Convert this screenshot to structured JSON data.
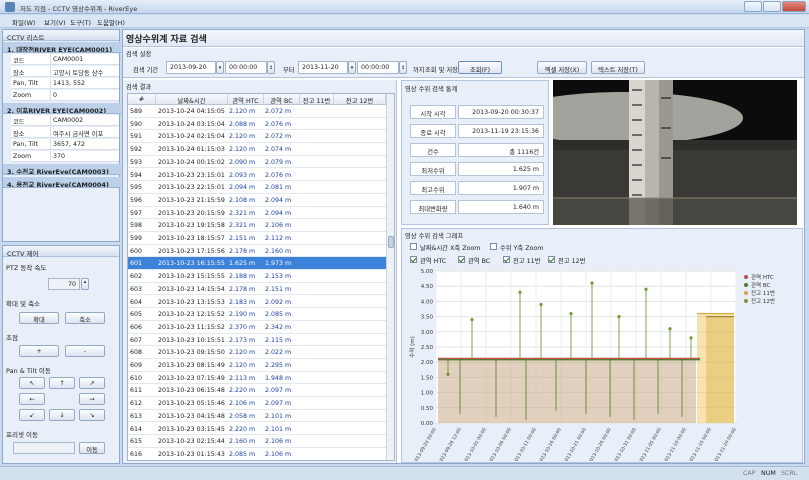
{
  "window": {
    "title": "저도 지점 - CCTV 영상수위계 - RiverEye"
  },
  "menu": [
    "파일(W)",
    "보기(V)",
    "도구(T)",
    "도움말(H)"
  ],
  "cctv_list": {
    "title": "CCTV 리스트",
    "cameras": [
      {
        "header": "1. 대장천RIVER EYE(CAM0001)",
        "props": [
          [
            "코드",
            "CAM0001"
          ],
          [
            "장소",
            "고양시 토당동 상수"
          ],
          [
            "Pan, Tilt",
            "1413, 552"
          ],
          [
            "Zoom",
            "0"
          ]
        ]
      },
      {
        "header": "2. 이포RIVER EYE(CAM0002)",
        "props": [
          [
            "코드",
            "CAM0002"
          ],
          [
            "장소",
            "여주시 금사면 이포"
          ],
          [
            "Pan, Tilt",
            "3657, 472"
          ],
          [
            "Zoom",
            "370"
          ]
        ]
      },
      {
        "header": "3. 수전교 RiverEye(CAM0003)"
      },
      {
        "header": "4. 용전교 RiverEye(CAM0004)"
      }
    ]
  },
  "cctv_control": {
    "title": "CCTV 제어",
    "ptz_label": "PTZ 동작 속도",
    "ptz_speed": "70",
    "zoom_label": "확대 및 축소",
    "zoom_in": "확대",
    "zoom_out": "축소",
    "focus_label": "초점",
    "focus_plus": "+",
    "focus_minus": "-",
    "pantilt_label": "Pan & Tilt 이동",
    "arrows": [
      "↖",
      "↑",
      "↗",
      "←",
      "",
      "→",
      "↙",
      "↓",
      "↘"
    ],
    "preset_label": "프리셋 이동",
    "preset_button": "이동"
  },
  "search": {
    "page_title": "영상수위계 자료 검색",
    "settings_label": "검색 설정",
    "period_label": "검색 기간",
    "start_date": "2013-09-20",
    "start_time": "00:00:00",
    "from_label": "부터",
    "end_date": "2013-11-20",
    "end_time": "00:00:00",
    "to_label": "까지",
    "query_save_label": "조회 및 저장",
    "query_button": "조회(F)",
    "excel_button": "엑셀 저장(X)",
    "text_button": "텍스트 저장(T)"
  },
  "results": {
    "title": "검색 결과",
    "columns": [
      "#",
      "날짜&시간",
      "관역 HTC",
      "관역 BC",
      "전고 11번",
      "전고 12번"
    ],
    "rows": [
      [
        "589",
        "2013-10-24 04:15:05",
        "2.120 m",
        "2.072 m"
      ],
      [
        "590",
        "2013-10-24 03:15:04",
        "2.088 m",
        "2.076 m"
      ],
      [
        "591",
        "2013-10-24 02:15:04",
        "2.120 m",
        "2.072 m"
      ],
      [
        "592",
        "2013-10-24 01:15:03",
        "2.120 m",
        "2.074 m"
      ],
      [
        "593",
        "2013-10-24 00:15:02",
        "2.090 m",
        "2.079 m"
      ],
      [
        "594",
        "2013-10-23 23:15:01",
        "2.093 m",
        "2.076 m"
      ],
      [
        "595",
        "2013-10-23 22:15:01",
        "2.094 m",
        "2.081 m"
      ],
      [
        "596",
        "2013-10-23 21:15:59",
        "2.108 m",
        "2.094 m"
      ],
      [
        "597",
        "2013-10-23 20:15:59",
        "2.321 m",
        "2.094 m"
      ],
      [
        "598",
        "2013-10-23 19:15:58",
        "2.321 m",
        "2.106 m"
      ],
      [
        "599",
        "2013-10-23 18:15:57",
        "2.151 m",
        "2.112 m"
      ],
      [
        "600",
        "2013-10-23 17:15:56",
        "2.178 m",
        "2.160 m"
      ],
      [
        "601",
        "2013-10-23 16:15:55",
        "1.625 m",
        "1.973 m"
      ],
      [
        "602",
        "2013-10-23 15:15:55",
        "2.188 m",
        "2.153 m"
      ],
      [
        "603",
        "2013-10-23 14:15:54",
        "2.178 m",
        "2.151 m"
      ],
      [
        "604",
        "2013-10-23 13:15:53",
        "2.183 m",
        "2.092 m"
      ],
      [
        "605",
        "2013-10-23 12:15:52",
        "2.190 m",
        "2.085 m"
      ],
      [
        "606",
        "2013-10-23 11:15:52",
        "2.370 m",
        "2.342 m"
      ],
      [
        "607",
        "2013-10-23 10:15:51",
        "2.173 m",
        "2.115 m"
      ],
      [
        "608",
        "2013-10-23 09:15:50",
        "2.120 m",
        "2.022 m"
      ],
      [
        "609",
        "2013-10-23 08:15:49",
        "2.120 m",
        "2.295 m"
      ],
      [
        "610",
        "2013-10-23 07:15:49",
        "2.113 m",
        "1.948 m"
      ],
      [
        "611",
        "2013-10-23 06:15:48",
        "2.220 m",
        "2.097 m"
      ],
      [
        "612",
        "2013-10-23 05:15:46",
        "2.106 m",
        "2.097 m"
      ],
      [
        "613",
        "2013-10-23 04:15:48",
        "2.058 m",
        "2.101 m"
      ],
      [
        "614",
        "2013-10-23 03:15:45",
        "2.220 m",
        "2.101 m"
      ],
      [
        "615",
        "2013-10-23 02:15:44",
        "2.160 m",
        "2.106 m"
      ],
      [
        "616",
        "2013-10-23 01:15:43",
        "2.085 m",
        "2.106 m"
      ]
    ],
    "selected_index": 12
  },
  "stats": {
    "title": "영상 수위 검색 통계",
    "items": [
      [
        "시작 시각",
        "2013-09-20 00:30:37"
      ],
      [
        "종료 시각",
        "2013-11-19 23:15:36"
      ],
      [
        "건수",
        "총 1116건"
      ],
      [
        "최저수위",
        "1.625 m"
      ],
      [
        "최고수위",
        "1.907 m"
      ],
      [
        "최대변화량",
        "1.640 m"
      ]
    ]
  },
  "graph": {
    "title": "영상 수위 검색 그래프",
    "opt_x_zoom": "날짜&시간 X축 Zoom",
    "opt_y_zoom": "수위 Y축 Zoom",
    "series_checks": [
      "관역 HTC",
      "관역 BC",
      "전고 11번",
      "전고 12번"
    ]
  },
  "chart_data": {
    "type": "line",
    "ylabel": "수위 (m)",
    "ylim": [
      0,
      5
    ],
    "yticks": [
      "5.00",
      "4.50",
      "4.00",
      "3.50",
      "3.00",
      "2.50",
      "2.00",
      "1.50",
      "1.00",
      "0.50",
      "0.00"
    ],
    "xticks": [
      "2013-09-20 00:00",
      "2013-09-26 12:00",
      "2013-10-01 00:00",
      "2013-10-06 00:00",
      "2013-10-11 00:00",
      "2013-10-16 00:00",
      "2013-10-21 00:00",
      "2013-10-26 00:00",
      "2013-10-31 00:00",
      "2013-11-05 00:00",
      "2013-11-10 00:00",
      "2013-11-15 00:00",
      "2013-11-20 00:00"
    ],
    "legend_position": "top-right",
    "series": [
      {
        "name": "관역 HTC",
        "color": "#c0504d",
        "level": 2.12,
        "spikes": [
          [
            0.04,
            1.6
          ],
          [
            0.12,
            3.4
          ],
          [
            0.28,
            4.3
          ],
          [
            0.35,
            3.9
          ],
          [
            0.45,
            3.6
          ],
          [
            0.52,
            4.6
          ],
          [
            0.61,
            3.5
          ],
          [
            0.7,
            4.4
          ],
          [
            0.78,
            3.1
          ],
          [
            0.85,
            2.8
          ]
        ]
      },
      {
        "name": "관역 BC",
        "color": "#4f7a28",
        "level": 2.08,
        "spikes": [
          [
            0.08,
            0.3
          ],
          [
            0.2,
            0.2
          ],
          [
            0.3,
            0.1
          ],
          [
            0.4,
            0.4
          ],
          [
            0.5,
            0.3
          ],
          [
            0.58,
            0.2
          ],
          [
            0.66,
            0.1
          ],
          [
            0.74,
            0.3
          ],
          [
            0.82,
            0.2
          ]
        ]
      },
      {
        "name": "전고 11번",
        "color": "#d9a441",
        "level": 3.6,
        "start": 0.87
      },
      {
        "name": "전고 12번",
        "color": "#9b8a3b",
        "level": 3.5,
        "start": 0.9
      }
    ]
  },
  "statusbar": [
    "CAP",
    "NUM",
    "SCRL"
  ]
}
